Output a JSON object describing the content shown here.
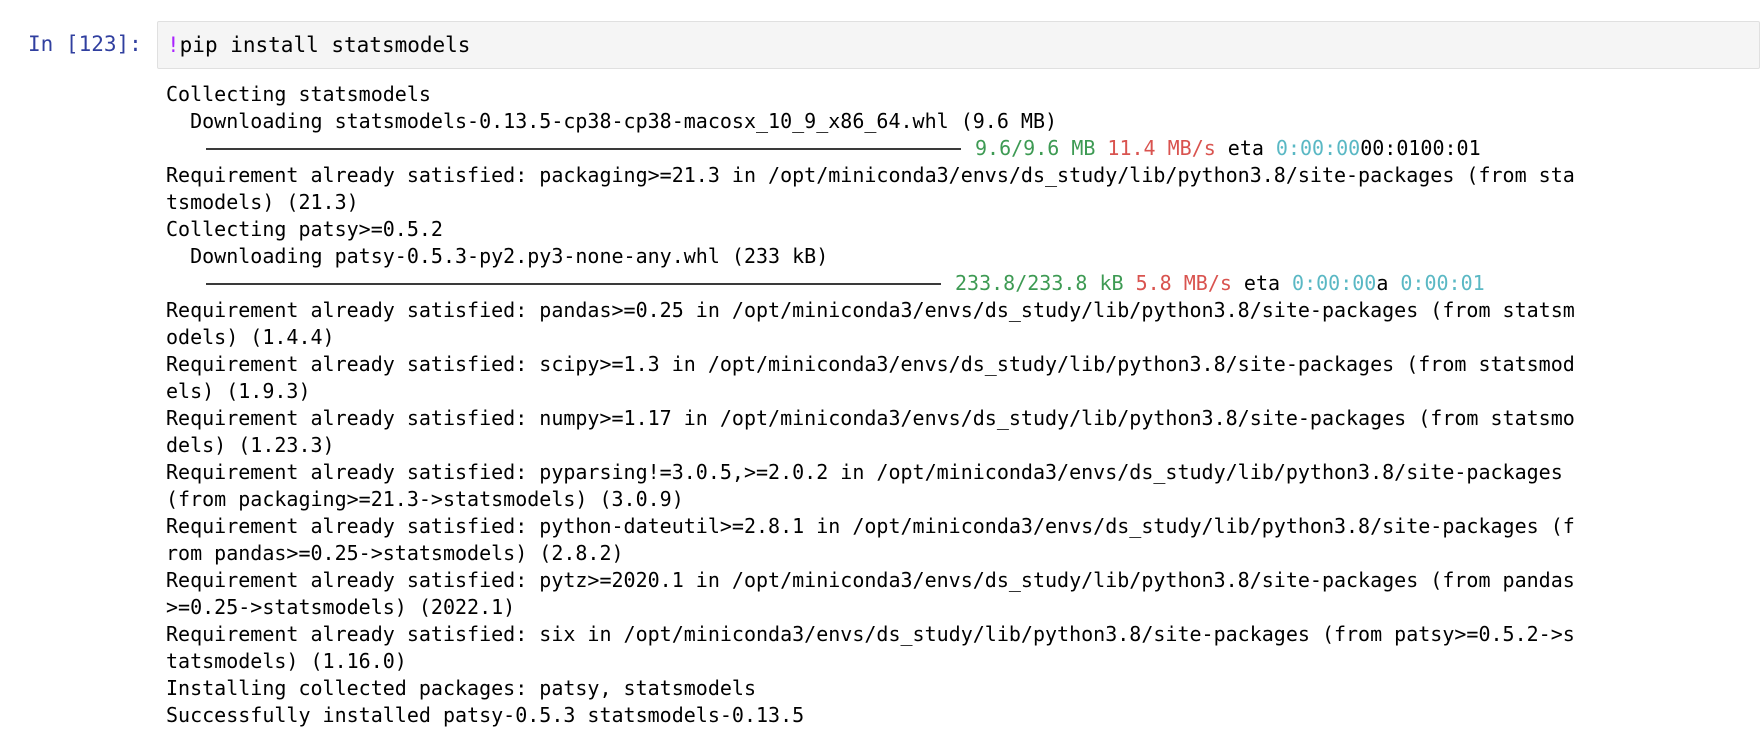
{
  "cell": {
    "prompt": "In [123]:",
    "input": {
      "bang": "!",
      "command": "pip install statsmodels"
    }
  },
  "output": {
    "lines": [
      "Collecting statsmodels",
      "  Downloading statsmodels-0.13.5-cp38-cp38-macosx_10_9_x86_64.whl (9.6 MB)",
      "Requirement already satisfied: packaging>=21.3 in /opt/miniconda3/envs/ds_study/lib/python3.8/site-packages (from sta",
      "tsmodels) (21.3)",
      "Collecting patsy>=0.5.2",
      "  Downloading patsy-0.5.3-py2.py3-none-any.whl (233 kB)",
      "Requirement already satisfied: pandas>=0.25 in /opt/miniconda3/envs/ds_study/lib/python3.8/site-packages (from statsm",
      "odels) (1.4.4)",
      "Requirement already satisfied: scipy>=1.3 in /opt/miniconda3/envs/ds_study/lib/python3.8/site-packages (from statsmod",
      "els) (1.9.3)",
      "Requirement already satisfied: numpy>=1.17 in /opt/miniconda3/envs/ds_study/lib/python3.8/site-packages (from statsmo",
      "dels) (1.23.3)",
      "Requirement already satisfied: pyparsing!=3.0.5,>=2.0.2 in /opt/miniconda3/envs/ds_study/lib/python3.8/site-packages",
      "(from packaging>=21.3->statsmodels) (3.0.9)",
      "Requirement already satisfied: python-dateutil>=2.8.1 in /opt/miniconda3/envs/ds_study/lib/python3.8/site-packages (f",
      "rom pandas>=0.25->statsmodels) (2.8.2)",
      "Requirement already satisfied: pytz>=2020.1 in /opt/miniconda3/envs/ds_study/lib/python3.8/site-packages (from pandas",
      ">=0.25->statsmodels) (2022.1)",
      "Requirement already satisfied: six in /opt/miniconda3/envs/ds_study/lib/python3.8/site-packages (from patsy>=0.5.2->s",
      "tatsmodels) (1.16.0)",
      "Installing collected packages: patsy, statsmodels",
      "Successfully installed patsy-0.5.3 statsmodels-0.13.5"
    ],
    "progress1": {
      "size": "9.6/9.6 MB",
      "speed": "11.4 MB/s",
      "eta_label": "eta",
      "eta_time": "0:00:00",
      "eta_rest": "00:0100:01"
    },
    "progress2": {
      "size": "233.8/233.8 kB",
      "speed": "5.8 MB/s",
      "eta_label": "eta",
      "eta_time": "0:00:00",
      "eta_mid": "a",
      "eta_time2": "0:00:01"
    }
  },
  "colors": {
    "prompt": "#303f9f",
    "bang": "#aa22ff",
    "size": "#3d9a53",
    "speed": "#d9534f",
    "eta": "#5ab8c4"
  }
}
